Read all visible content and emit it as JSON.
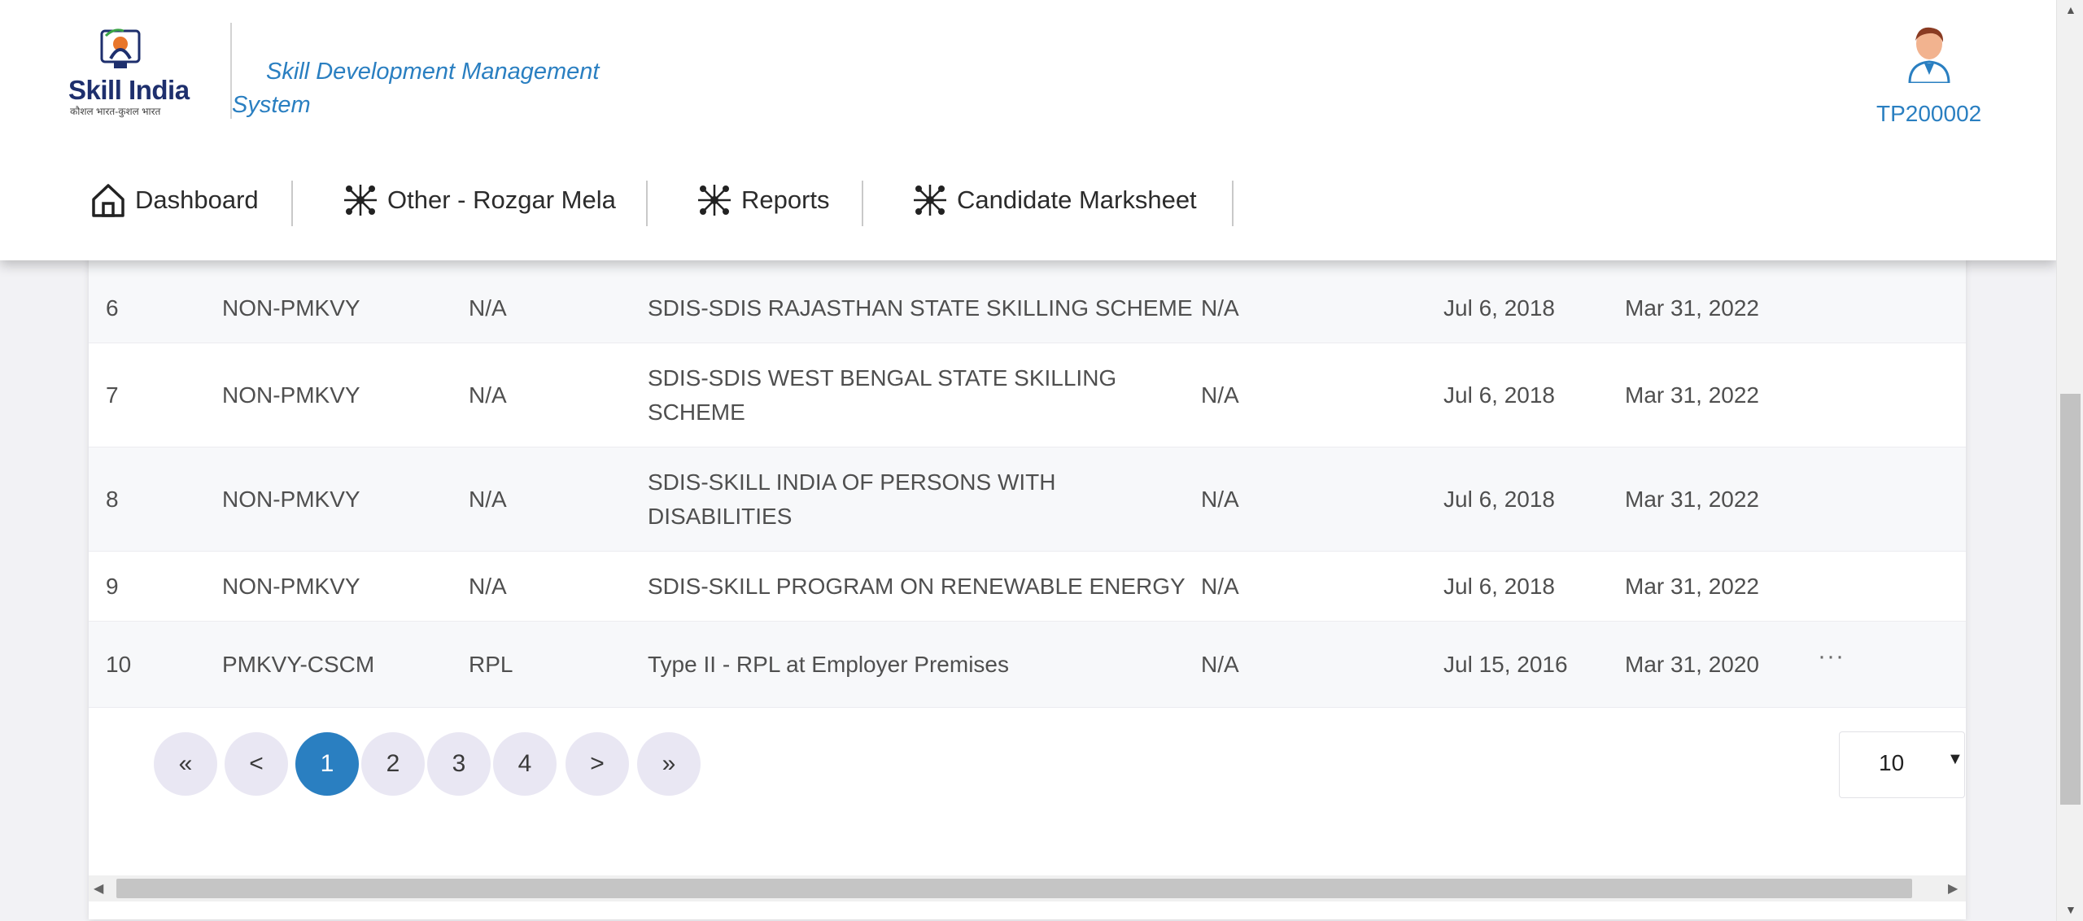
{
  "header": {
    "logo_word": "Skill India",
    "logo_tagline": "कौशल भारत-कुशल भारत",
    "title": "Skill Development Management System",
    "user_id": "TP200002"
  },
  "nav": [
    {
      "label": "Dashboard",
      "icon": "home-icon"
    },
    {
      "label": "Other - Rozgar Mela",
      "icon": "network-icon"
    },
    {
      "label": "Reports",
      "icon": "network-icon"
    },
    {
      "label": "Candidate Marksheet",
      "icon": "network-icon"
    }
  ],
  "table": {
    "rows": [
      {
        "no": "6",
        "type": "NON-PMKVY",
        "sub": "N/A",
        "scheme": "SDIS-SDIS RAJASTHAN STATE SKILLING SCHEME",
        "extra": "N/A",
        "start": "Jul 6, 2018",
        "end": "Mar 31, 2022",
        "actions": ""
      },
      {
        "no": "7",
        "type": "NON-PMKVY",
        "sub": "N/A",
        "scheme": "SDIS-SDIS WEST BENGAL STATE SKILLING SCHEME",
        "extra": "N/A",
        "start": "Jul 6, 2018",
        "end": "Mar 31, 2022",
        "actions": ""
      },
      {
        "no": "8",
        "type": "NON-PMKVY",
        "sub": "N/A",
        "scheme": "SDIS-SKILL INDIA OF PERSONS WITH DISABILITIES",
        "extra": "N/A",
        "start": "Jul 6, 2018",
        "end": "Mar 31, 2022",
        "actions": ""
      },
      {
        "no": "9",
        "type": "NON-PMKVY",
        "sub": "N/A",
        "scheme": "SDIS-SKILL PROGRAM ON RENEWABLE ENERGY",
        "extra": "N/A",
        "start": "Jul 6, 2018",
        "end": "Mar 31, 2022",
        "actions": ""
      },
      {
        "no": "10",
        "type": "PMKVY-CSCM",
        "sub": "RPL",
        "scheme": "Type II - RPL at Employer Premises",
        "extra": "N/A",
        "start": "Jul 15, 2016",
        "end": "Mar 31, 2020",
        "actions": "···"
      }
    ]
  },
  "pagination": {
    "first": "«",
    "prev": "<",
    "pages": [
      "1",
      "2",
      "3",
      "4"
    ],
    "current": "1",
    "next": ">",
    "last": "»"
  },
  "page_size": {
    "value": "10",
    "arrow": "▼"
  },
  "colors": {
    "accent": "#2a7fc1",
    "page_button": "#e9e7f3"
  }
}
